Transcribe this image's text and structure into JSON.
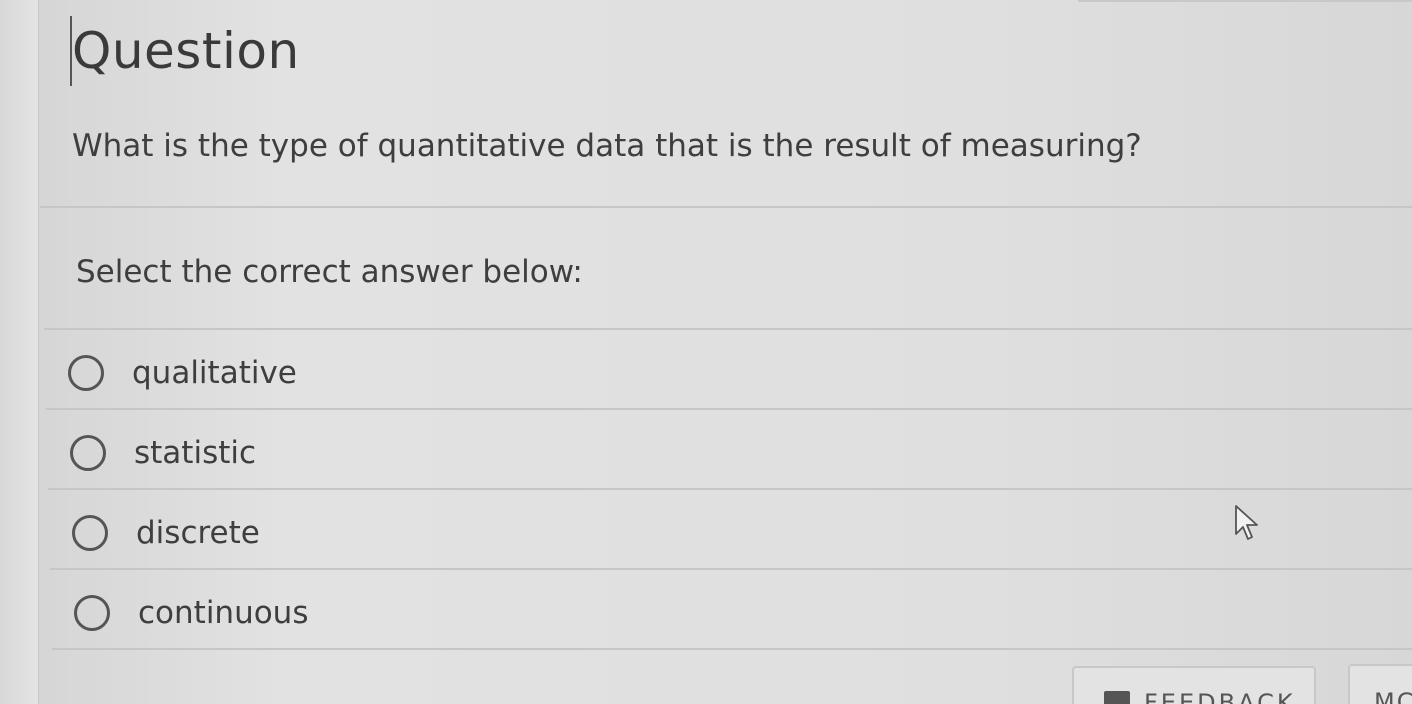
{
  "question": {
    "title": "Question",
    "text": "What is the type of quantitative data that is the result of measuring?"
  },
  "prompt": "Select the correct answer below:",
  "options": [
    {
      "label": "qualitative",
      "selected": false
    },
    {
      "label": "statistic",
      "selected": false
    },
    {
      "label": "discrete",
      "selected": false
    },
    {
      "label": "continuous",
      "selected": false
    }
  ],
  "footer": {
    "feedback_label": "FEEDBACK",
    "more_label": "MC"
  },
  "icons": {
    "radio": "radio-button-icon",
    "cursor": "mouse-pointer-icon",
    "feedback": "feedback-icon"
  }
}
